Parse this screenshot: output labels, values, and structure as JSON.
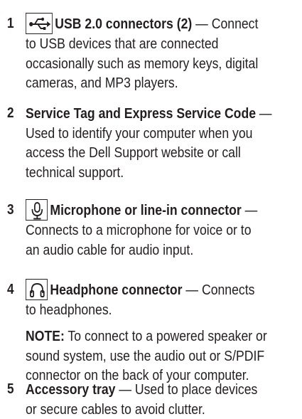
{
  "items": [
    {
      "number": "1",
      "icon": "usb-icon",
      "title": "USB 2.0 connectors (2)",
      "dash": " — ",
      "lines": [
        "Connect",
        "to USB devices that are connected",
        "occasionally such as memory keys, digital",
        "cameras, and MP3 players."
      ]
    },
    {
      "number": "2",
      "title": "Service Tag and Express Service Code",
      "dash": " —",
      "lines": [
        "",
        "Used to identify your computer when you",
        "access the Dell Support website or call",
        "technical support."
      ]
    },
    {
      "number": "3",
      "icon": "microphone-icon",
      "title": "Microphone or line-in connector",
      "dash": " —",
      "lines": [
        "",
        "Connects to a microphone for voice or to",
        "an audio cable for audio input."
      ]
    },
    {
      "number": "4",
      "icon": "headphone-icon",
      "title": "Headphone connector",
      "dash": " — ",
      "lines": [
        "Connects",
        "to headphones."
      ]
    },
    {
      "number": "5",
      "title": "Accessory tray",
      "dash": " — ",
      "lines": [
        "Used to place devices",
        "or secure cables to avoid clutter."
      ]
    }
  ],
  "note": {
    "label": "NOTE:",
    "lines": [
      " To connect to a powered speaker or",
      "sound system, use the audio out or S/PDIF",
      "connector on the back of your computer."
    ]
  }
}
